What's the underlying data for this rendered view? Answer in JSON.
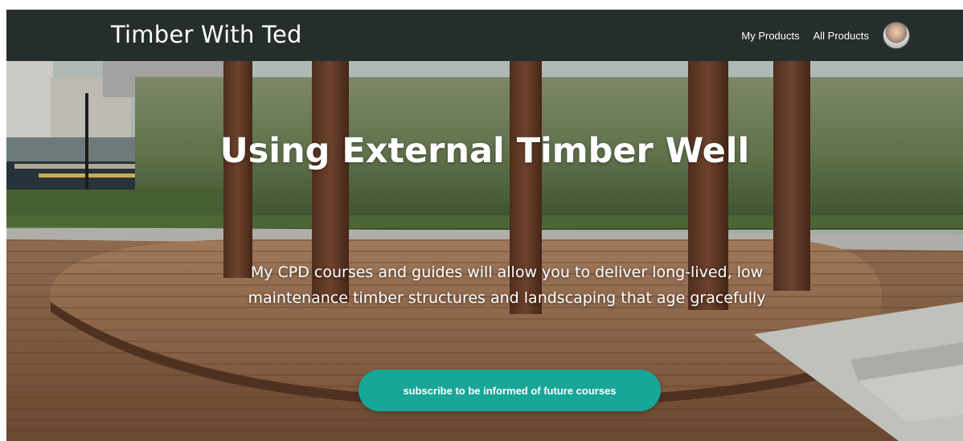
{
  "navbar": {
    "brand": "Timber With Ted",
    "links": [
      {
        "label": "My Products"
      },
      {
        "label": "All Products"
      }
    ],
    "avatar_icon": "user-avatar"
  },
  "hero": {
    "title": "Using External Timber Well",
    "subtitle": "My CPD courses and guides will allow you to deliver long-lived, low maintenance timber structures and landscaping that age gracefully",
    "cta_label": "subscribe to be informed of future courses",
    "background_image": "timber-deck-pergola-photo"
  },
  "colors": {
    "navbar_bg": "#262e2d",
    "cta_bg": "#17a697",
    "text": "#ffffff"
  }
}
